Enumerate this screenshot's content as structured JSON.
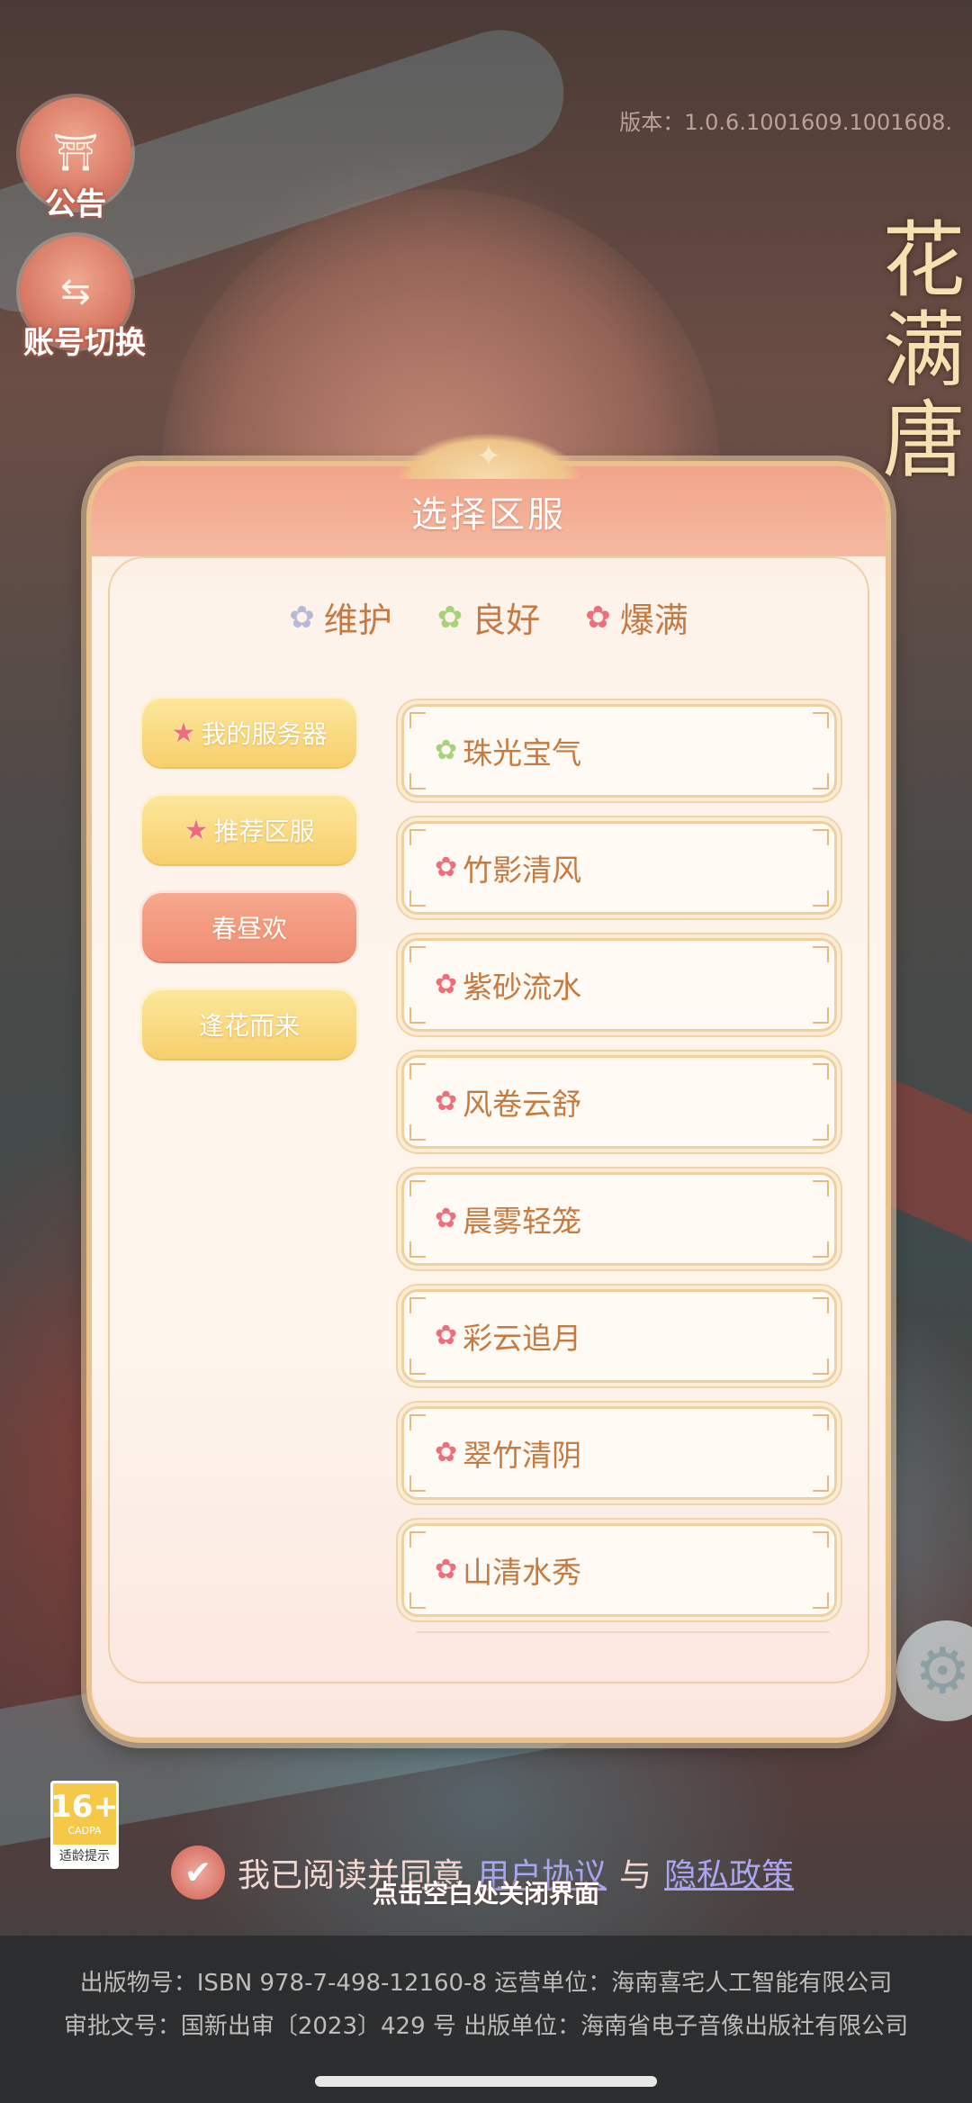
{
  "top_left": {
    "notice_label": "公告",
    "switch_label": "账号切换"
  },
  "version": "版本：1.0.6.1001609.1001608.",
  "game_title": "花满唐",
  "panel": {
    "title": "选择区服",
    "legend": [
      {
        "label": "维护",
        "color": "#b6bad8"
      },
      {
        "label": "良好",
        "color": "#a8d27a"
      },
      {
        "label": "爆满",
        "color": "#ee6f7a"
      }
    ],
    "tabs": [
      {
        "label": "我的服务器",
        "style": "yellow",
        "star": true
      },
      {
        "label": "推荐区服",
        "style": "yellow",
        "star": true
      },
      {
        "label": "春昼欢",
        "style": "pink",
        "star": false
      },
      {
        "label": "逢花而来",
        "style": "yellow",
        "star": false
      }
    ],
    "servers": [
      {
        "name": "珠光宝气",
        "status": "良好"
      },
      {
        "name": "竹影清风",
        "status": "爆满"
      },
      {
        "name": "紫砂流水",
        "status": "爆满"
      },
      {
        "name": "风卷云舒",
        "status": "爆满"
      },
      {
        "name": "晨雾轻笼",
        "status": "爆满"
      },
      {
        "name": "彩云追月",
        "status": "爆满"
      },
      {
        "name": "翠竹清阴",
        "status": "爆满"
      },
      {
        "name": "山清水秀",
        "status": "爆满"
      }
    ]
  },
  "age_rating": {
    "age": "16+",
    "org": "CADPA",
    "tip": "适龄提示"
  },
  "agreement": {
    "prefix": "我已阅读并同意",
    "user_agreement": "用户协议",
    "and": "与",
    "privacy_policy": "隐私政策"
  },
  "close_hint": "点击空白处关闭界面",
  "footer": {
    "line1": "出版物号：ISBN 978-7-498-12160-8 运营单位：海南喜宅人工智能有限公司",
    "line2": "审批文号：国新出审〔2023〕429 号 出版单位：海南省电子音像出版社有限公司"
  }
}
